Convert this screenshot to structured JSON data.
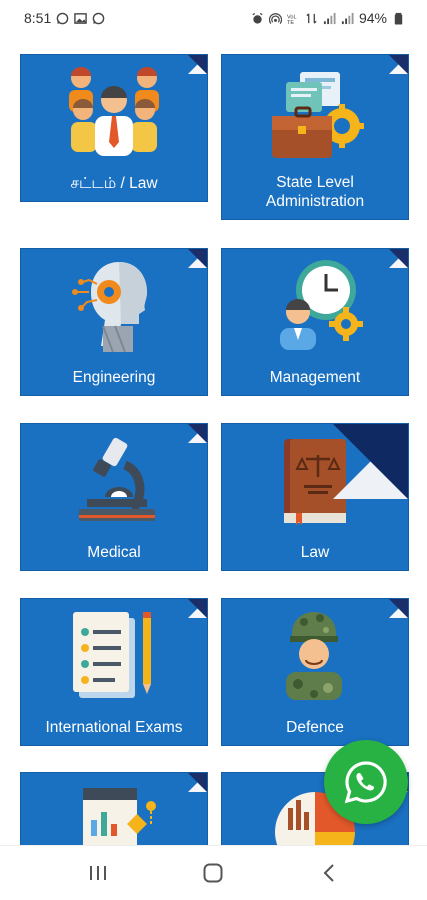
{
  "status_bar": {
    "time": "8:51",
    "battery": "94%",
    "network_label": "VoLTE"
  },
  "tiles": [
    {
      "label": "சட்டம் / Law",
      "icon": "people-group-icon"
    },
    {
      "label": "State Level Administration",
      "icon": "briefcase-gear-icon"
    },
    {
      "label": "Engineering",
      "icon": "robot-head-icon"
    },
    {
      "label": "Management",
      "icon": "clock-manager-icon"
    },
    {
      "label": "Medical",
      "icon": "microscope-icon"
    },
    {
      "label": "Law",
      "icon": "law-book-icon"
    },
    {
      "label": "International Exams",
      "icon": "checklist-pencil-icon"
    },
    {
      "label": "Defence",
      "icon": "soldier-icon"
    },
    {
      "label": "",
      "icon": "analytics-report-icon"
    },
    {
      "label": "",
      "icon": "finance-chart-icon"
    }
  ],
  "colors": {
    "tile": "#1a70c1",
    "fold": "#1a2f6a",
    "whatsapp": "#27b243"
  },
  "fab": {
    "icon": "whatsapp-icon"
  },
  "nav_bar": {
    "recents": "recents-icon",
    "home": "home-icon",
    "back": "back-icon"
  }
}
